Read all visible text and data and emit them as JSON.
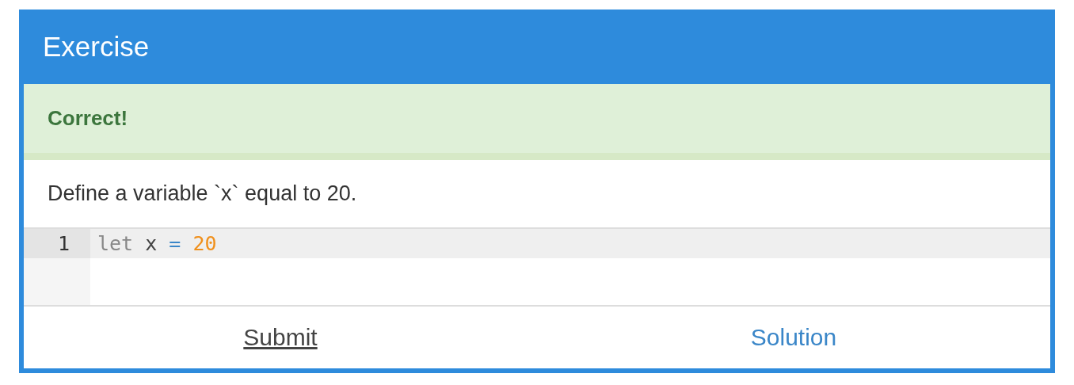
{
  "window": {
    "title": "Exercise"
  },
  "feedback": {
    "kind": "success",
    "text": "Correct!"
  },
  "prompt": "Define a variable `x` equal to 20.",
  "editor": {
    "lines": [
      {
        "number": "1",
        "active": true,
        "tokens": [
          {
            "kind": "keyword",
            "text": "let"
          },
          {
            "kind": "plain",
            "text": "x"
          },
          {
            "kind": "operator",
            "text": "="
          },
          {
            "kind": "number",
            "text": "20"
          }
        ]
      }
    ]
  },
  "buttons": [
    {
      "label": "Submit",
      "kind": "plain"
    },
    {
      "label": "Solution",
      "kind": "link"
    }
  ]
}
